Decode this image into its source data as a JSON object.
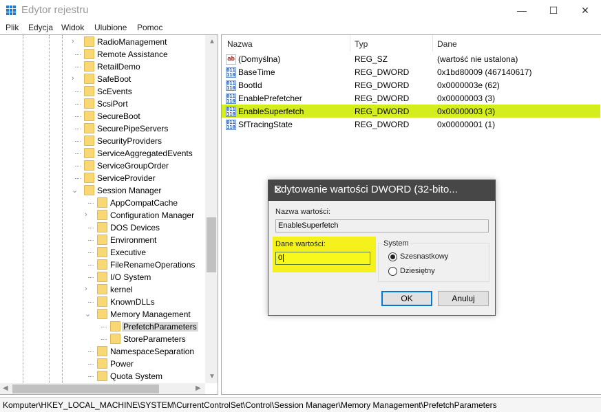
{
  "window": {
    "title": "Edytor rejestru",
    "minimize": "—",
    "maximize": "☐",
    "close": "✕"
  },
  "menu": [
    "Plik",
    "Edycja",
    "Widok",
    "Ulubione",
    "Pomoc"
  ],
  "tree": [
    {
      "label": "RadioManagement",
      "level": 1,
      "expander": "collapsed"
    },
    {
      "label": "Remote Assistance",
      "level": 1
    },
    {
      "label": "RetailDemo",
      "level": 1
    },
    {
      "label": "SafeBoot",
      "level": 1,
      "expander": "collapsed"
    },
    {
      "label": "ScEvents",
      "level": 1
    },
    {
      "label": "ScsiPort",
      "level": 1
    },
    {
      "label": "SecureBoot",
      "level": 1
    },
    {
      "label": "SecurePipeServers",
      "level": 1
    },
    {
      "label": "SecurityProviders",
      "level": 1
    },
    {
      "label": "ServiceAggregatedEvents",
      "level": 1
    },
    {
      "label": "ServiceGroupOrder",
      "level": 1
    },
    {
      "label": "ServiceProvider",
      "level": 1
    },
    {
      "label": "Session Manager",
      "level": 1,
      "expander": "expanded"
    },
    {
      "label": "AppCompatCache",
      "level": 2
    },
    {
      "label": "Configuration Manager",
      "level": 2,
      "expander": "collapsed"
    },
    {
      "label": "DOS Devices",
      "level": 2
    },
    {
      "label": "Environment",
      "level": 2
    },
    {
      "label": "Executive",
      "level": 2
    },
    {
      "label": "FileRenameOperations",
      "level": 2
    },
    {
      "label": "I/O System",
      "level": 2
    },
    {
      "label": "kernel",
      "level": 2,
      "expander": "collapsed"
    },
    {
      "label": "KnownDLLs",
      "level": 2
    },
    {
      "label": "Memory Management",
      "level": 2,
      "expander": "expanded"
    },
    {
      "label": "PrefetchParameters",
      "level": 3,
      "selected": true
    },
    {
      "label": "StoreParameters",
      "level": 3
    },
    {
      "label": "NamespaceSeparation",
      "level": 2
    },
    {
      "label": "Power",
      "level": 2
    },
    {
      "label": "Quota System",
      "level": 2
    }
  ],
  "list": {
    "columns": [
      "Nazwa",
      "Typ",
      "Dane"
    ],
    "rows": [
      {
        "name": "(Domyślna)",
        "type": "REG_SZ",
        "data": "(wartość nie ustalona)",
        "icon": "string-value-icon"
      },
      {
        "name": "BaseTime",
        "type": "REG_DWORD",
        "data": "0x1bd80009 (467140617)",
        "icon": "binary-value-icon"
      },
      {
        "name": "BootId",
        "type": "REG_DWORD",
        "data": "0x0000003e (62)",
        "icon": "binary-value-icon"
      },
      {
        "name": "EnablePrefetcher",
        "type": "REG_DWORD",
        "data": "0x00000003 (3)",
        "icon": "binary-value-icon"
      },
      {
        "name": "EnableSuperfetch",
        "type": "REG_DWORD",
        "data": "0x00000003 (3)",
        "icon": "binary-value-icon",
        "highlighted": true
      },
      {
        "name": "SfTracingState",
        "type": "REG_DWORD",
        "data": "0x00000001 (1)",
        "icon": "binary-value-icon"
      }
    ],
    "highlight_color": "#d4ed1c"
  },
  "status": "Komputer\\HKEY_LOCAL_MACHINE\\SYSTEM\\CurrentControlSet\\Control\\Session Manager\\Memory Management\\PrefetchParameters",
  "dialog": {
    "title": "Edytowanie wartości DWORD (32-bito...",
    "name_label": "Nazwa wartości:",
    "name_value": "EnableSuperfetch",
    "data_label": "Dane wartości:",
    "data_value": "0",
    "base_group": "System",
    "base_hex": "Szesnastkowy",
    "base_dec": "Dziesiętny",
    "base_selected": "hex",
    "ok": "OK",
    "cancel": "Anuluj",
    "highlight_color": "#f4f11c"
  }
}
